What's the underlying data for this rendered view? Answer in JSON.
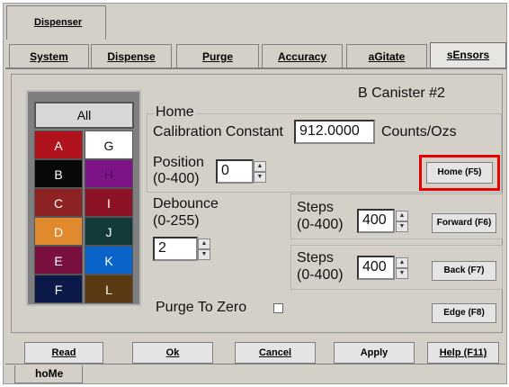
{
  "window": {
    "top_tab": "Dispenser",
    "bottom_tab": "hoMe"
  },
  "tabs": [
    {
      "label": "System"
    },
    {
      "label": "Dispense"
    },
    {
      "label": "Purge"
    },
    {
      "label": "Accuracy"
    },
    {
      "label": "aGitate"
    },
    {
      "label": "sEnsors"
    }
  ],
  "canister_title": "B Canister #2",
  "colors": {
    "all_label": "All",
    "cells": [
      {
        "label": "A",
        "bg": "#b0131c",
        "fg": "#ffffff"
      },
      {
        "label": "G",
        "bg": "#ffffff",
        "fg": "#111111"
      },
      {
        "label": "B",
        "bg": "#080808",
        "fg": "#ffffff"
      },
      {
        "label": "H",
        "bg": "#7c1487",
        "fg": "#5a0a66"
      },
      {
        "label": "C",
        "bg": "#8e2323",
        "fg": "#ffffff"
      },
      {
        "label": "I",
        "bg": "#8c1326",
        "fg": "#ffffff"
      },
      {
        "label": "D",
        "bg": "#e08a2d",
        "fg": "#ffffff"
      },
      {
        "label": "J",
        "bg": "#123a3a",
        "fg": "#ffffff"
      },
      {
        "label": "E",
        "bg": "#7a1040",
        "fg": "#ffffff"
      },
      {
        "label": "K",
        "bg": "#0a63c8",
        "fg": "#ffffff"
      },
      {
        "label": "F",
        "bg": "#0c1a4a",
        "fg": "#ffffff"
      },
      {
        "label": "L",
        "bg": "#5a3a12",
        "fg": "#ffffff"
      }
    ]
  },
  "home": {
    "group_label": "Home",
    "cal_label": "Calibration Constant",
    "cal_value": "912.0000",
    "cal_units": "Counts/Ozs",
    "position_label": "Position",
    "position_range": "(0-400)",
    "position_value": "0",
    "home_button": "Home (F5)"
  },
  "debounce": {
    "label": "Debounce",
    "range": "(0-255)",
    "value": "2"
  },
  "forward": {
    "label": "Steps",
    "range": "(0-400)",
    "value": "400",
    "button": "Forward (F6)"
  },
  "back": {
    "label": "Steps",
    "range": "(0-400)",
    "value": "400",
    "button": "Back (F7)"
  },
  "purge": {
    "label": "Purge To Zero",
    "button": "Edge (F8)"
  },
  "bottom_buttons": [
    {
      "label": "Read"
    },
    {
      "label": "Ok"
    },
    {
      "label": "Cancel"
    },
    {
      "label": "Apply"
    },
    {
      "label": "Help (F11)"
    }
  ],
  "highlight_color": "#e60000"
}
